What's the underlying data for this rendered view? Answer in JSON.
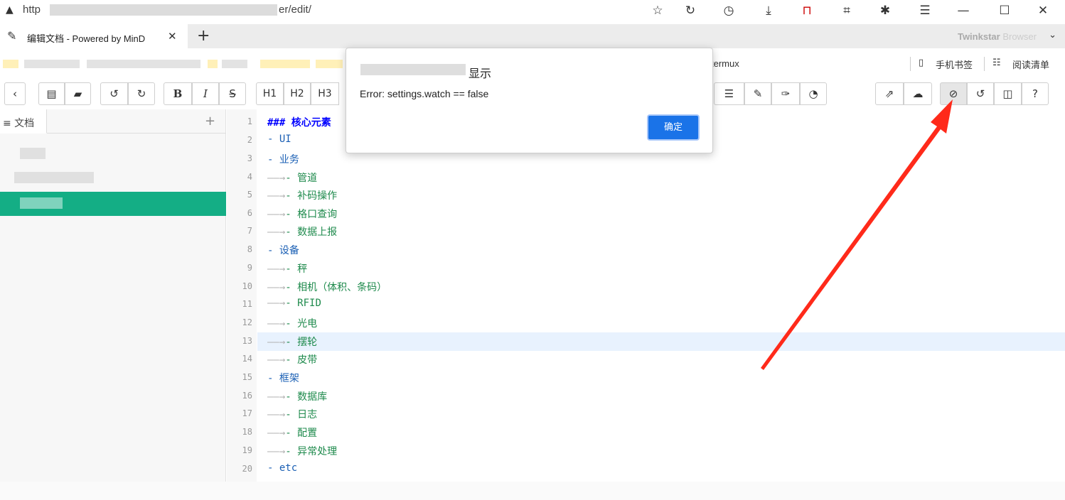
{
  "browser": {
    "url_prefix": "http",
    "url_suffix": "er/edit/",
    "tab_title": "编辑文档 - Powered by MinD",
    "brand_bold": "Twinkstar",
    "brand_light": "Browser",
    "bookmark_termux": "termux",
    "bookmark_mobile": "手机书签",
    "bookmark_reading": "阅读清单"
  },
  "toolbar": {
    "h1": "H1",
    "h2": "H2",
    "h3": "H3",
    "bold": "B",
    "italic": "I",
    "strike": "S"
  },
  "sidebar": {
    "tab_label": "≡ 文档",
    "add_label": "+"
  },
  "editor": {
    "line_numbers": [
      "1",
      "2",
      "3",
      "4",
      "5",
      "6",
      "7",
      "8",
      "9",
      "10",
      "11",
      "12",
      "13",
      "14",
      "15",
      "16",
      "17",
      "18",
      "19",
      "20"
    ],
    "lines": [
      {
        "indent": "",
        "text": "### 核心元素"
      },
      {
        "indent": "",
        "text": "- UI"
      },
      {
        "indent": "",
        "text": "- 业务"
      },
      {
        "indent": "——→",
        "text": "- 管道"
      },
      {
        "indent": "——→",
        "text": "- 补码操作"
      },
      {
        "indent": "——→",
        "text": "- 格口查询"
      },
      {
        "indent": "——→",
        "text": "- 数据上报"
      },
      {
        "indent": "",
        "text": "- 设备"
      },
      {
        "indent": "——→",
        "text": "- 秤"
      },
      {
        "indent": "——→",
        "text": "- 相机（体积、条码）"
      },
      {
        "indent": "——→",
        "text": "- RFID"
      },
      {
        "indent": "——→",
        "text": "- 光电"
      },
      {
        "indent": "——→",
        "text": "- 摆轮"
      },
      {
        "indent": "——→",
        "text": "- 皮带"
      },
      {
        "indent": "",
        "text": "- 框架"
      },
      {
        "indent": "——→",
        "text": "- 数据库"
      },
      {
        "indent": "——→",
        "text": "- 日志"
      },
      {
        "indent": "——→",
        "text": "- 配置"
      },
      {
        "indent": "——→",
        "text": "- 异常处理"
      },
      {
        "indent": "",
        "text": "- etc"
      }
    ]
  },
  "dialog": {
    "title": "显示",
    "message": "Error: settings.watch == false",
    "ok_label": "确定"
  },
  "colors": {
    "accent": "#14ae85",
    "dialog_button": "#1a73e8",
    "annotation_arrow": "#ff2a1a"
  }
}
